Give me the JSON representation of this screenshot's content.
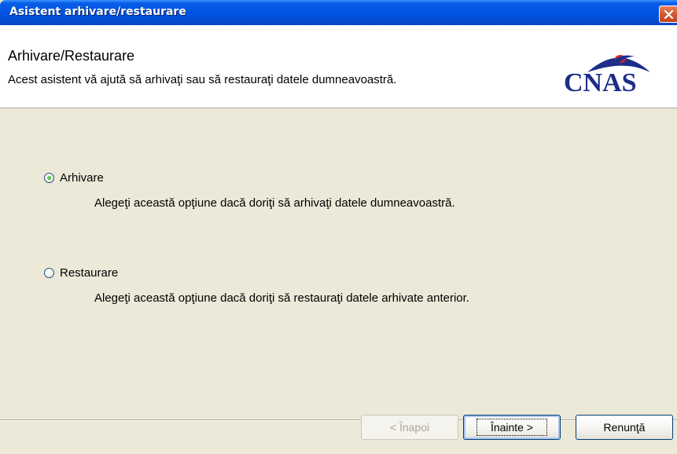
{
  "window": {
    "title": "Asistent arhivare/restaurare"
  },
  "header": {
    "title": "Arhivare/Restaurare",
    "subtitle": "Acest asistent vă ajută să arhivaţi sau să restauraţi datele dumneavoastră.",
    "logo_text": "CNAS"
  },
  "options": [
    {
      "label": "Arhivare",
      "description": "Alegeţi această opţiune dacă doriţi să arhivaţi datele dumneavoastră.",
      "selected": true
    },
    {
      "label": "Restaurare",
      "description": "Alegeţi această opţiune dacă doriţi să restauraţi datele arhivate anterior.",
      "selected": false
    }
  ],
  "buttons": {
    "back": "< Înapoi",
    "next": "Înainte >",
    "cancel": "Renunţă"
  },
  "colors": {
    "title_bar": "#0054e3",
    "dialog_bg": "#ece9d8",
    "logo": "#1c2e8a",
    "radio_selected": "#21a121"
  },
  "icons": {
    "close": "close-icon",
    "logo": "cnas-logo"
  }
}
